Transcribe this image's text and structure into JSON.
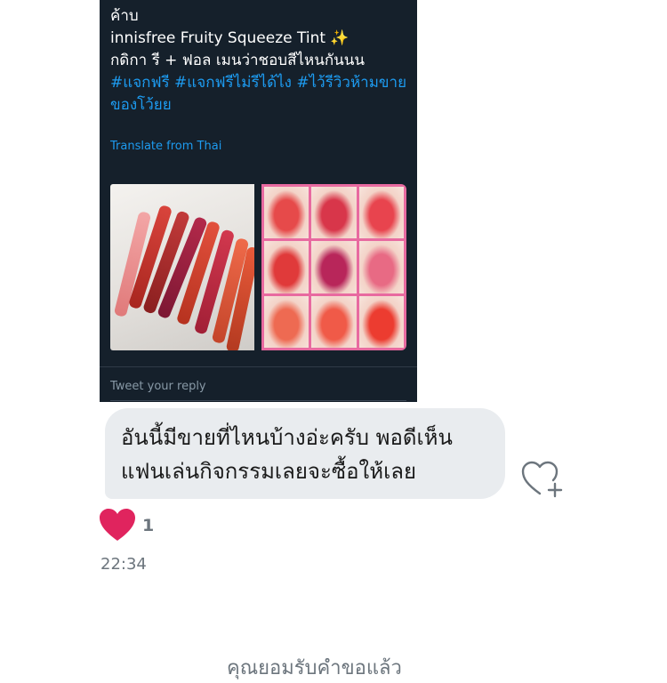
{
  "tweet": {
    "line1": "ค้าบ",
    "line2": "innisfree Fruity Squeeze Tint ✨",
    "line3": "กดิกา รี + ฟอล เมนว่าชอบสีไหนกันนน",
    "hashtags": "#แจกฟรี #แจกฟรีไม่รีได้ไง #ไว้รีวิวห้ามขายของโว้ยย",
    "translate_label": "Translate from Thai",
    "reply_placeholder": "Tweet your reply"
  },
  "message": {
    "line1": "อันนี้มีขายที่ไหนบ้างอ่ะครับ พอดีเห็น",
    "line2": "แฟนเล่นกิจกรรมเลยจะซื้อให้เลย",
    "reaction_count": "1",
    "timestamp": "22:34"
  },
  "footer": {
    "text": "คุณยอมรับคำขอแล้ว"
  },
  "colors": {
    "tweet_bg": "#15202b",
    "link": "#1d9bf0",
    "bubble_bg": "#e9ecef",
    "heart": "#e0245e"
  },
  "icons": [
    "add-reaction-heart-icon",
    "heart-reaction-icon"
  ]
}
